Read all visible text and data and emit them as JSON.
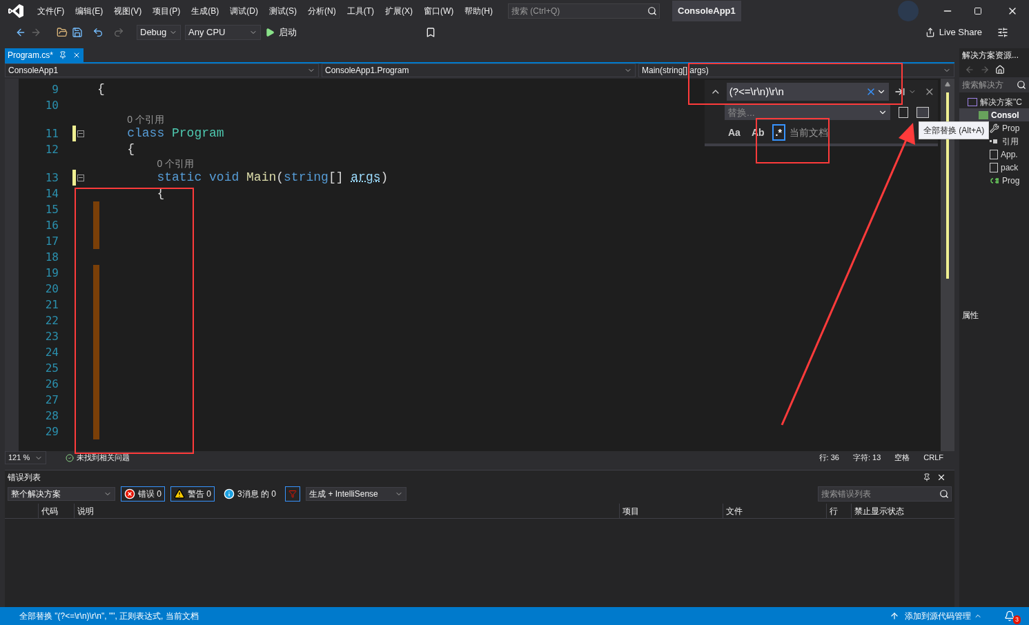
{
  "menu": [
    "文件(F)",
    "编辑(E)",
    "视图(V)",
    "项目(P)",
    "生成(B)",
    "调试(D)",
    "测试(S)",
    "分析(N)",
    "工具(T)",
    "扩展(X)",
    "窗口(W)",
    "帮助(H)"
  ],
  "search": {
    "placeholder": "搜索 (Ctrl+Q)"
  },
  "solution_badge": "ConsoleApp1",
  "toolbar": {
    "configuration": "Debug",
    "platform": "Any CPU",
    "start": "启动",
    "live_share": "Live Share"
  },
  "editor": {
    "tab": {
      "label": "Program.cs*",
      "selected": true
    },
    "nav": [
      "ConsoleApp1",
      "ConsoleApp1.Program",
      "Main(string[] args)"
    ],
    "lines": [
      {
        "number": "9",
        "tokens": [
          {
            "text": "{",
            "kind": "plain"
          }
        ],
        "changed": false,
        "collapsible": false,
        "matched": false
      },
      {
        "number": "10",
        "changed": false,
        "collapsible": false,
        "matched": false
      },
      {
        "number": "11",
        "lens": "0 个引用",
        "tokens": [
          {
            "text": "    class",
            "kind": "keyword"
          },
          {
            "text": " Program",
            "kind": "type"
          }
        ],
        "changed": true,
        "collapsible": true,
        "matched": false
      },
      {
        "number": "12",
        "tokens": [
          {
            "text": "    {",
            "kind": "plain"
          }
        ],
        "changed": false,
        "collapsible": false,
        "matched": false
      },
      {
        "number": "13",
        "lens": "0 个引用",
        "tokens": [
          {
            "text": "        static void",
            "kind": "keyword"
          },
          {
            "text": " Main",
            "kind": "method"
          },
          {
            "text": "(",
            "kind": "plain"
          },
          {
            "text": "string",
            "kind": "keyword"
          },
          {
            "text": "[] ",
            "kind": "plain"
          },
          {
            "text": "args",
            "kind": "param"
          },
          {
            "text": ")",
            "kind": "plain"
          }
        ],
        "changed": true,
        "collapsible": true,
        "matched": false
      },
      {
        "number": "14",
        "tokens": [
          {
            "text": "        {",
            "kind": "plain"
          }
        ],
        "changed": false,
        "collapsible": false,
        "matched": false
      },
      {
        "number": "15",
        "changed": false,
        "collapsible": false,
        "matched": true
      },
      {
        "number": "16",
        "changed": false,
        "collapsible": false,
        "matched": true
      },
      {
        "number": "17",
        "changed": false,
        "collapsible": false,
        "matched": true
      },
      {
        "number": "18",
        "changed": false,
        "collapsible": false,
        "matched": false
      },
      {
        "number": "19",
        "changed": false,
        "collapsible": false,
        "matched": true
      },
      {
        "number": "20",
        "changed": false,
        "collapsible": false,
        "matched": true
      },
      {
        "number": "21",
        "changed": false,
        "collapsible": false,
        "matched": true
      },
      {
        "number": "22",
        "changed": false,
        "collapsible": false,
        "matched": true
      },
      {
        "number": "23",
        "changed": false,
        "collapsible": false,
        "matched": true
      },
      {
        "number": "24",
        "changed": false,
        "collapsible": false,
        "matched": true
      },
      {
        "number": "25",
        "changed": false,
        "collapsible": false,
        "matched": true
      },
      {
        "number": "26",
        "changed": false,
        "collapsible": false,
        "matched": true
      },
      {
        "number": "27",
        "changed": false,
        "collapsible": false,
        "matched": true
      },
      {
        "number": "28",
        "changed": false,
        "collapsible": false,
        "matched": true
      },
      {
        "number": "29",
        "changed": false,
        "collapsible": false,
        "matched": true
      }
    ],
    "find": {
      "value": "(?<=\\r\\n)\\r\\n",
      "replace_placeholder": "替换...",
      "options": [
        {
          "label": "Aa",
          "selected": false
        },
        {
          "label": "Ab",
          "selected": false
        },
        {
          "label": ".*",
          "selected": true
        }
      ],
      "scope": "当前文档",
      "tooltip": "全部替换 (Alt+A)"
    },
    "status": {
      "zoom": "121 %",
      "issues": "未找到相关问题",
      "line": "行: 36",
      "char": "字符: 13",
      "indent": "空格",
      "eol": "CRLF"
    }
  },
  "solution_explorer": {
    "title": "解决方案资源...",
    "search_placeholder": "搜索解决方",
    "items": [
      {
        "label": "解决方案\"C",
        "kind": "solution",
        "selected": false,
        "children": [
          {
            "label": "Consol",
            "kind": "project",
            "selected": true,
            "children": [
              {
                "label": "Prop",
                "kind": "properties",
                "selected": false
              },
              {
                "label": "引用",
                "kind": "references",
                "selected": false
              },
              {
                "label": "App.",
                "kind": "file",
                "selected": false
              },
              {
                "label": "pack",
                "kind": "file",
                "selected": false
              },
              {
                "label": "Prog",
                "kind": "csharp",
                "selected": false
              }
            ]
          }
        ]
      }
    ]
  },
  "properties": {
    "title": "属性"
  },
  "error_list": {
    "title": "错误列表",
    "scope": "整个解决方案",
    "filters": [
      {
        "kind": "error",
        "label": "错误 0",
        "selected": true
      },
      {
        "kind": "warning",
        "label": "警告 0",
        "selected": true
      },
      {
        "kind": "info",
        "label": "3消息 的 0",
        "selected": false
      }
    ],
    "source": "生成 + IntelliSense",
    "search_placeholder": "搜索错误列表",
    "columns": [
      "代码",
      "说明",
      "项目",
      "文件",
      "行",
      "禁止显示状态"
    ]
  },
  "status_bar": {
    "message": "全部替换 \"(?<=\\r\\n)\\r\\n\", \"\", 正则表达式, 当前文档",
    "source_control": "添加到源代码管理",
    "notifications": "3"
  }
}
